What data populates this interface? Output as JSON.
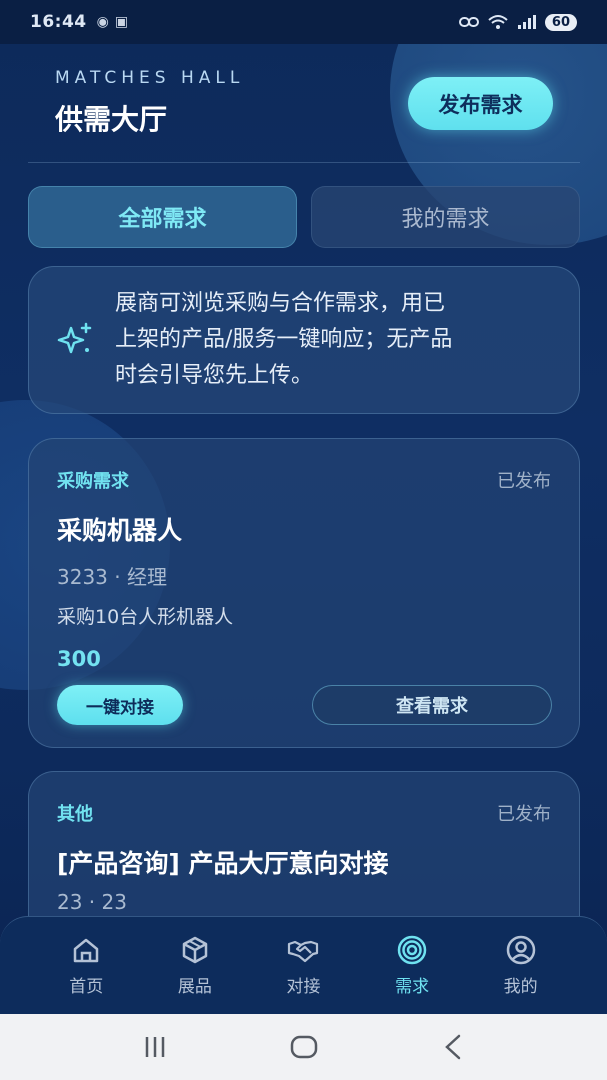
{
  "status_bar": {
    "time": "16:44",
    "battery": "60"
  },
  "header": {
    "subtitle_en": "MATCHES HALL",
    "title": "供需大厅",
    "publish_button": "发布需求"
  },
  "tabs": [
    {
      "label": "全部需求",
      "active": true
    },
    {
      "label": "我的需求",
      "active": false
    }
  ],
  "info_panel": {
    "lines": [
      "展商可浏览采购与合作需求，用已",
      "上架的产品/服务一键响应；无产品",
      "时会引导您先上传。"
    ]
  },
  "cards": [
    {
      "category": "采购需求",
      "status": "已发布",
      "title": "采购机器人",
      "meta": "3233 · 经理",
      "description": "采购10台人形机器人",
      "price": "300",
      "connect_label": "一键对接",
      "view_label": "查看需求"
    },
    {
      "category": "其他",
      "status": "已发布",
      "title": "[产品咨询] 产品大厅意向对接",
      "meta": "23 · 23"
    }
  ],
  "bottom_nav": [
    {
      "label": "首页",
      "icon": "home-icon",
      "active": false
    },
    {
      "label": "展品",
      "icon": "box-icon",
      "active": false
    },
    {
      "label": "对接",
      "icon": "handshake-icon",
      "active": false
    },
    {
      "label": "需求",
      "icon": "target-icon",
      "active": true
    },
    {
      "label": "我的",
      "icon": "user-icon",
      "active": false
    }
  ],
  "colors": {
    "accent": "#6fe2f0",
    "background": "#0d2a5a"
  }
}
